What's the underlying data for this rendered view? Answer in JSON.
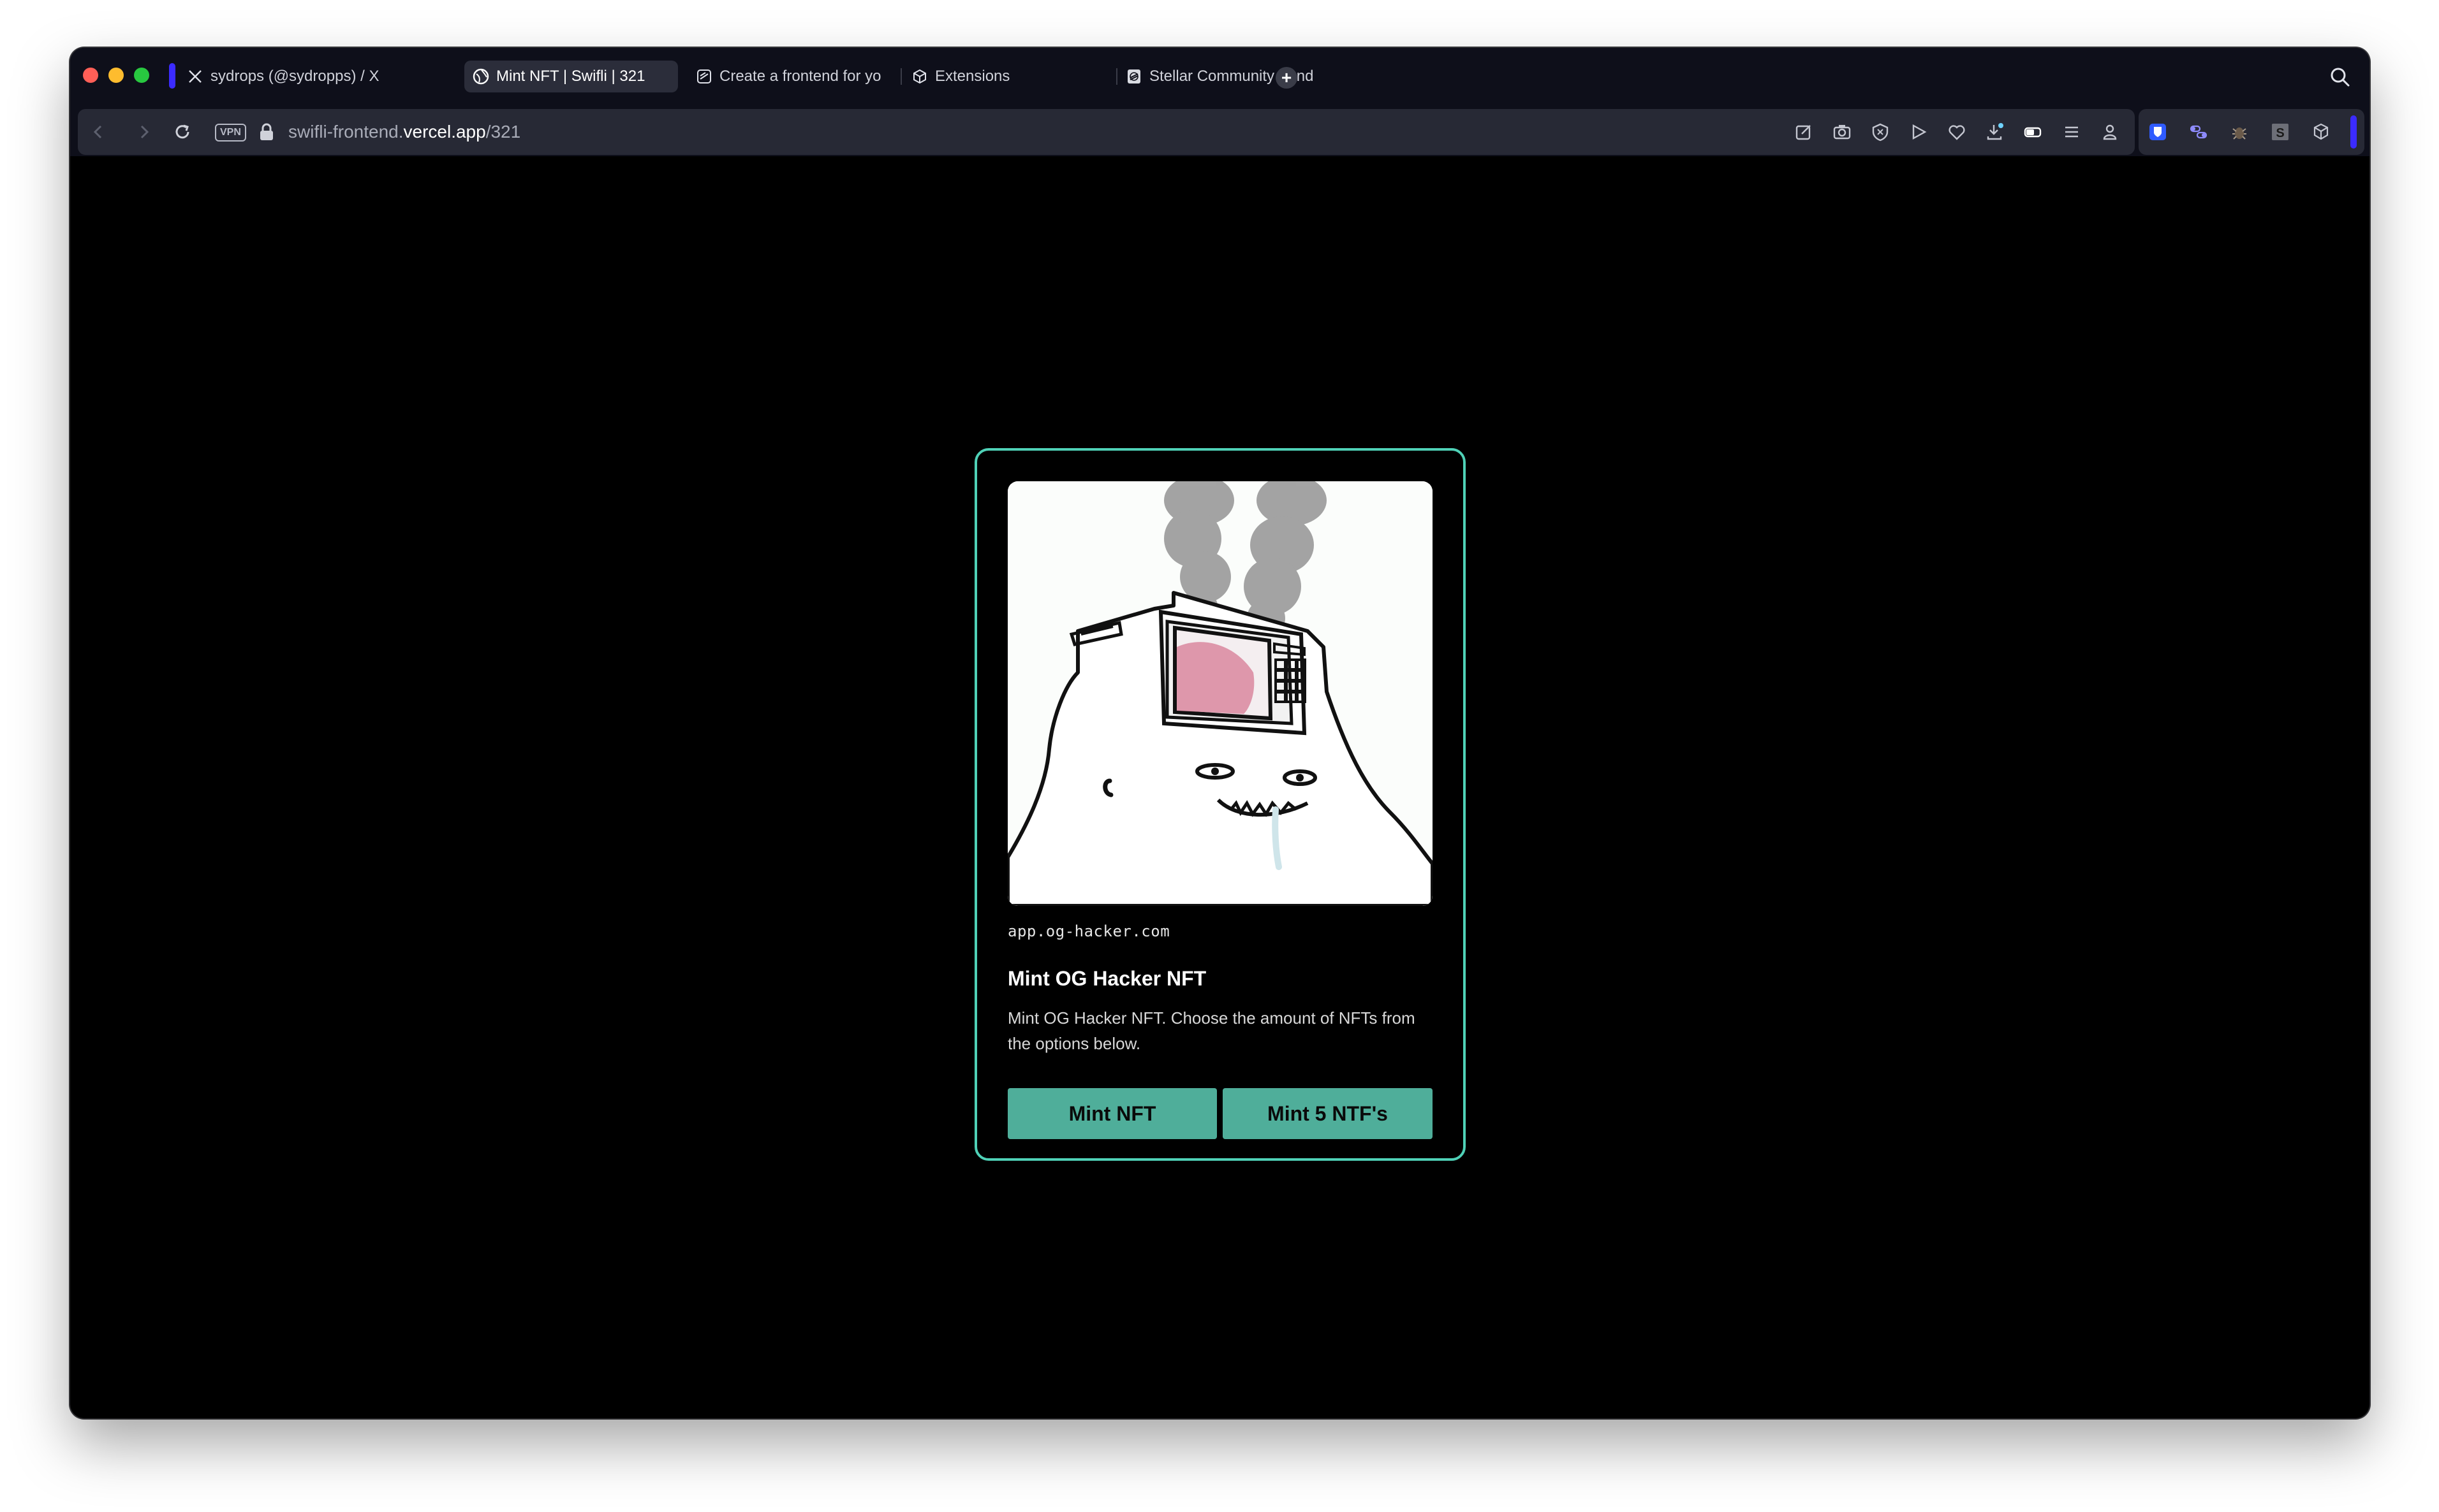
{
  "browser": {
    "tabs": [
      {
        "label": "sydrops (@sydropps) / X",
        "icon": "x-logo-icon",
        "active": false
      },
      {
        "label": "Mint NFT | Swifli | 321",
        "icon": "globe-icon",
        "active": true
      },
      {
        "label": "Create a frontend for yo",
        "icon": "openai-icon",
        "active": false
      },
      {
        "label": "Extensions",
        "icon": "cube-icon",
        "active": false
      },
      {
        "label": "Stellar Community Fund",
        "icon": "stellar-icon",
        "active": false
      }
    ],
    "new_tab": "+",
    "vpn_label": "VPN",
    "url_prefix": "swifli-frontend.",
    "url_host": "vercel.app",
    "url_path": "/321",
    "accent_color": "#3b2bff"
  },
  "card": {
    "domain": "app.og-hacker.com",
    "title": "Mint OG Hacker NFT",
    "description": "Mint OG Hacker NFT. Choose the amount of NFTs from the options below.",
    "buttons": {
      "mint": "Mint NFT",
      "mint5": "Mint 5 NTF's"
    },
    "border_color": "#4fd1b7",
    "button_color": "#4fae9a"
  }
}
